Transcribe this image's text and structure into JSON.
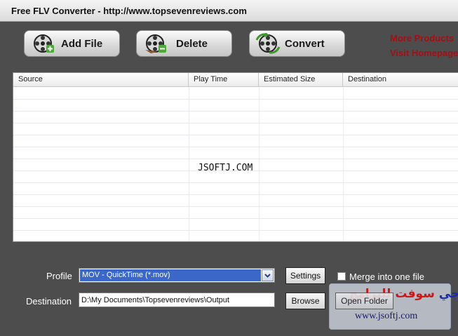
{
  "window": {
    "title": "Free FLV Converter - http://www.topsevenreviews.com"
  },
  "toolbar": {
    "add_file": "Add File",
    "delete": "Delete",
    "convert": "Convert"
  },
  "links": {
    "more_products": "More Products",
    "visit_homepage": "Visit Homepage"
  },
  "table": {
    "columns": [
      "Source",
      "Play Time",
      "Estimated Size",
      "Destination"
    ],
    "rows": []
  },
  "watermark": "JSOFTJ.COM",
  "profile": {
    "label": "Profile",
    "selected": "MOV - QuickTime (*.mov)",
    "settings_button": "Settings"
  },
  "merge": {
    "label": "Merge into one file",
    "checked": false
  },
  "destination": {
    "label": "Destination",
    "value": "D:\\My Documents\\Topsevenreviews\\Output",
    "browse_button": "Browse",
    "open_folder_button": "Open Folder"
  },
  "badge": {
    "arabic_text": "جي سوفت للبرامج",
    "url": "www.jsoftj.com"
  },
  "colors": {
    "background": "#4d4d4d",
    "link": "#a80d14",
    "selection": "#3b68c8"
  },
  "icons": {
    "add_file": "film-reel-plus-icon",
    "delete": "film-reel-minus-icon",
    "convert": "film-reel-convert-icon"
  }
}
